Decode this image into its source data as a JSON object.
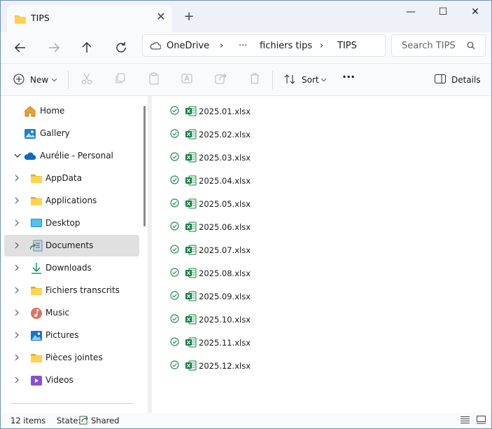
{
  "window": {
    "tab_title": "TIPS",
    "close_tab": "✕",
    "new_tab": "+",
    "minimize": "—",
    "maximize": "☐",
    "close": "✕"
  },
  "address": {
    "root": "OneDrive",
    "more": "···",
    "crumbs": [
      "fichiers tips",
      "TIPS"
    ],
    "separator": "›",
    "search_placeholder": "Search TIPS"
  },
  "toolbar": {
    "new_label": "New",
    "sort_label": "Sort",
    "more": "···",
    "details_label": "Details"
  },
  "sidebar": {
    "items": [
      {
        "label": "Home",
        "icon": "home-icon",
        "chevron": "none"
      },
      {
        "label": "Gallery",
        "icon": "gallery-icon",
        "chevron": "none"
      },
      {
        "label": "Aurélie - Personal",
        "icon": "onedrive-cloud-icon",
        "chevron": "down"
      },
      {
        "label": "AppData",
        "icon": "folder-icon",
        "chevron": "right"
      },
      {
        "label": "Applications",
        "icon": "folder-icon",
        "chevron": "right"
      },
      {
        "label": "Desktop",
        "icon": "desktop-icon",
        "chevron": "right"
      },
      {
        "label": "Documents",
        "icon": "documents-icon",
        "chevron": "right",
        "selected": true
      },
      {
        "label": "Downloads",
        "icon": "downloads-icon",
        "chevron": "right"
      },
      {
        "label": "Fichiers transcrits",
        "icon": "folder-icon",
        "chevron": "right"
      },
      {
        "label": "Music",
        "icon": "music-icon",
        "chevron": "right"
      },
      {
        "label": "Pictures",
        "icon": "pictures-icon",
        "chevron": "right"
      },
      {
        "label": "Pièces jointes",
        "icon": "folder-icon",
        "chevron": "right"
      },
      {
        "label": "Videos",
        "icon": "videos-icon",
        "chevron": "right"
      }
    ]
  },
  "files": [
    {
      "name": "2025.01.xlsx"
    },
    {
      "name": "2025.02.xlsx"
    },
    {
      "name": "2025.03.xlsx"
    },
    {
      "name": "2025.04.xlsx"
    },
    {
      "name": "2025.05.xlsx"
    },
    {
      "name": "2025.06.xlsx"
    },
    {
      "name": "2025.07.xlsx"
    },
    {
      "name": "2025.08.xlsx"
    },
    {
      "name": "2025.09.xlsx"
    },
    {
      "name": "2025.10.xlsx"
    },
    {
      "name": "2025.11.xlsx"
    },
    {
      "name": "2025.12.xlsx"
    }
  ],
  "status": {
    "count": "12 items",
    "state_label": "State:",
    "state_value": "Shared"
  },
  "colors": {
    "accent": "#0067c0",
    "folder": "#f4c542",
    "excel": "#107c41",
    "sync_ok": "#2e8b57",
    "selected": "#e0e0e0"
  }
}
